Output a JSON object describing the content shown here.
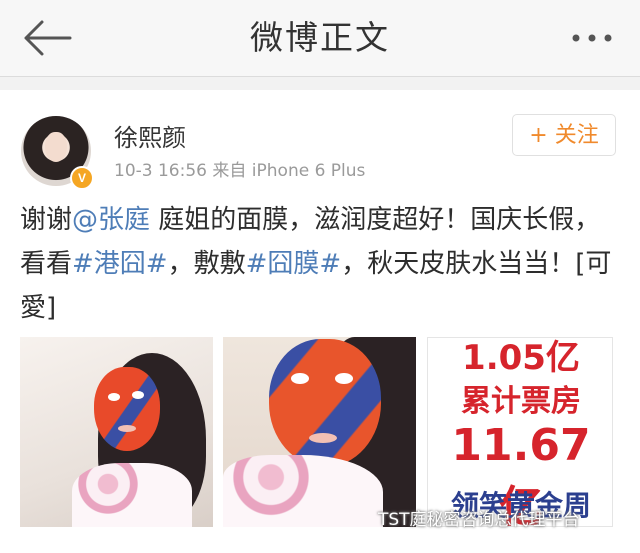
{
  "header": {
    "title": "微博正文",
    "back_icon": "arrow-left-icon",
    "more_icon": "more-dots-icon"
  },
  "post": {
    "user": {
      "name": "徐熙颜",
      "verified_badge": "V"
    },
    "time": "10-3 16:56",
    "source_prefix": "来自",
    "device": "iPhone 6 Plus",
    "follow_label": "+ 关注",
    "text": {
      "p1": "谢谢",
      "mention": "@张庭",
      "p2": " 庭姐的面膜，滋润度超好！国庆长假，看看",
      "tag1": "#港囧#",
      "p3": "，敷敷",
      "tag2": "#囧膜#",
      "p4": "，秋天皮肤水当当！[可愛]"
    },
    "images": [
      {
        "desc": "woman with red and blue face mask in mirror"
      },
      {
        "desc": "woman selfie with red and blue face mask"
      },
      {
        "desc": "red box office poster",
        "lines": [
          "1.05亿",
          "累计票房",
          "11.67亿",
          "领笑黄金周"
        ]
      }
    ]
  },
  "watermark": "TST庭秘密咨询总代理平台",
  "colors": {
    "accent_orange": "#f08a2c",
    "link_blue": "#4e7db7",
    "poster_red": "#d6242c"
  }
}
